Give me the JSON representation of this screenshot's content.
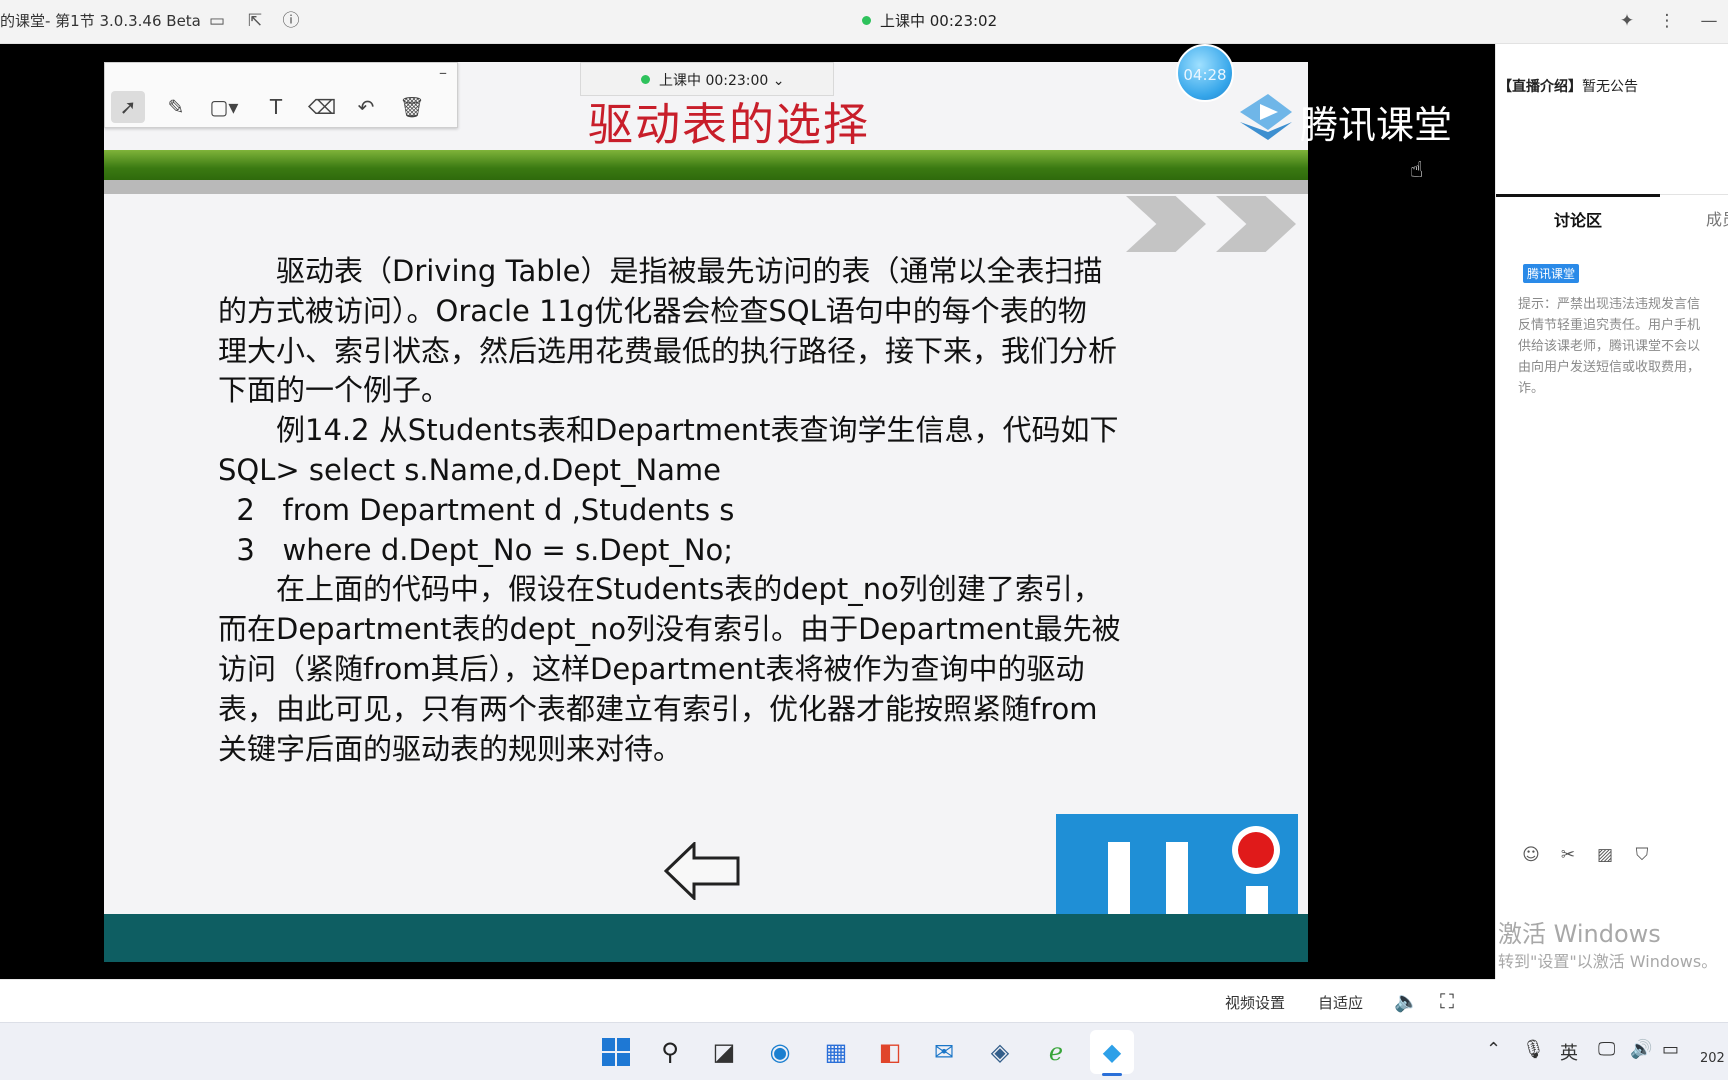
{
  "titlebar": {
    "title": "的课堂- 第1节 3.0.3.46 Beta",
    "live_status": "上课中 00:23:02"
  },
  "annotation_toolbar": {
    "tools": [
      "select-icon",
      "pen-icon",
      "rectangle-icon",
      "text-icon",
      "eraser-icon",
      "undo-icon",
      "trash-icon"
    ]
  },
  "live_pill": {
    "text": "上课中 00:23:00"
  },
  "timer_bubble": {
    "text": "04:28"
  },
  "brand": {
    "name": "腾讯课堂"
  },
  "slide": {
    "title": "驱动表的选择",
    "lines": [
      "　　驱动表（Driving Table）是指被最先访问的表（通常以全表扫描",
      "的方式被访问）。Oracle 11g优化器会检查SQL语句中的每个表的物",
      "理大小、索引状态，然后选用花费最低的执行路径，接下来，我们分析",
      "下面的一个例子。",
      "　　例14.2  从Students表和Department表查询学生信息，代码如下",
      "SQL> select s.Name,d.Dept_Name",
      "  2   from Department d ,Students s",
      "  3   where d.Dept_No = s.Dept_No;",
      "　　在上面的代码中，假设在Students表的dept_no列创建了索引，",
      "而在Department表的dept_no列没有索引。由于Department最先被",
      "访问（紧随from其后），这样Department表将被作为查询中的驱动",
      "表，由此可见，只有两个表都建立有索引，优化器才能按照紧随from",
      "关键字后面的驱动表的规则来对待。"
    ]
  },
  "sidebar": {
    "intro_label": "【直播介绍】",
    "intro_value": "暂无公告",
    "tab_active": "讨论区",
    "tab_other": "成员",
    "badge": "腾讯课堂",
    "tip_lines": [
      "提示：严禁出现违法违规发言信",
      "反情节轻重追究责任。用户手机",
      "供给该课老师，腾讯课堂不会以",
      "由向用户发送短信或收取费用，",
      "诈。"
    ],
    "input_icons": [
      "emoji-icon",
      "scissors-icon",
      "image-icon",
      "shield-icon"
    ]
  },
  "watermark": {
    "line1": "激活 Windows",
    "line2": "转到\"设置\"以激活 Windows。"
  },
  "controlbar": {
    "video_settings": "视频设置",
    "fit": "自适应"
  },
  "taskbar": {
    "ime": "英",
    "date_fragment": "202"
  },
  "colors": {
    "slide_title": "#c81e2a",
    "green_band": "#3b7a12",
    "teal_band": "#0e5e62",
    "live_dot": "#2ec25c",
    "badge": "#2a8ae8"
  }
}
